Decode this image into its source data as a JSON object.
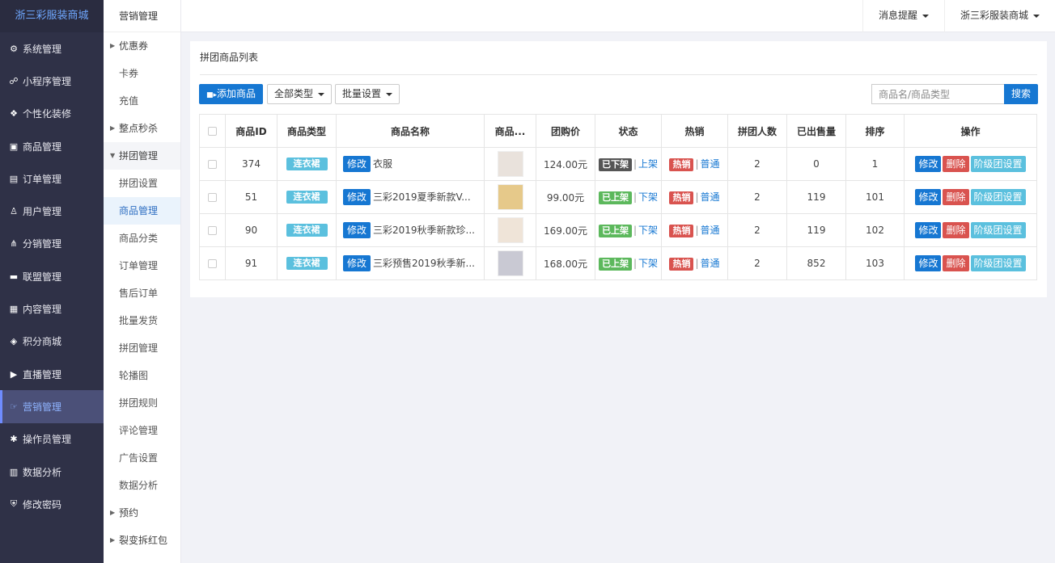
{
  "brand": "浙三彩服装商城",
  "nav": [
    {
      "label": "系统管理",
      "icon": "gear-icon",
      "glyph": "⚙"
    },
    {
      "label": "小程序管理",
      "icon": "link-icon",
      "glyph": "☍"
    },
    {
      "label": "个性化装修",
      "icon": "palette-icon",
      "glyph": "❖"
    },
    {
      "label": "商品管理",
      "icon": "bag-icon",
      "glyph": "▣"
    },
    {
      "label": "订单管理",
      "icon": "clipboard-icon",
      "glyph": "▤"
    },
    {
      "label": "用户管理",
      "icon": "user-icon",
      "glyph": "♙"
    },
    {
      "label": "分销管理",
      "icon": "sitemap-icon",
      "glyph": "⋔"
    },
    {
      "label": "联盟管理",
      "icon": "store-icon",
      "glyph": "▬"
    },
    {
      "label": "内容管理",
      "icon": "newspaper-icon",
      "glyph": "▦"
    },
    {
      "label": "积分商城",
      "icon": "cube-icon",
      "glyph": "◈"
    },
    {
      "label": "直播管理",
      "icon": "play-icon",
      "glyph": "▶"
    },
    {
      "label": "营销管理",
      "icon": "marketing-icon",
      "glyph": "☞"
    },
    {
      "label": "操作员管理",
      "icon": "cog-icon",
      "glyph": "✱"
    },
    {
      "label": "数据分析",
      "icon": "bar-chart-icon",
      "glyph": "▥"
    },
    {
      "label": "修改密码",
      "icon": "shield-icon",
      "glyph": "⛨"
    }
  ],
  "subnav": {
    "title": "营销管理",
    "items": [
      {
        "label": "优惠券",
        "type": "group"
      },
      {
        "label": "卡券",
        "type": "item"
      },
      {
        "label": "充值",
        "type": "item"
      },
      {
        "label": "整点秒杀",
        "type": "group"
      },
      {
        "label": "拼团管理",
        "type": "open"
      },
      {
        "label": "拼团设置",
        "type": "item"
      },
      {
        "label": "商品管理",
        "type": "active"
      },
      {
        "label": "商品分类",
        "type": "item"
      },
      {
        "label": "订单管理",
        "type": "item"
      },
      {
        "label": "售后订单",
        "type": "item"
      },
      {
        "label": "批量发货",
        "type": "item"
      },
      {
        "label": "拼团管理",
        "type": "item"
      },
      {
        "label": "轮播图",
        "type": "item"
      },
      {
        "label": "拼团规则",
        "type": "item"
      },
      {
        "label": "评论管理",
        "type": "item"
      },
      {
        "label": "广告设置",
        "type": "item"
      },
      {
        "label": "数据分析",
        "type": "item"
      },
      {
        "label": "预约",
        "type": "group"
      },
      {
        "label": "裂变拆红包",
        "type": "group"
      }
    ]
  },
  "header": {
    "messages": "消息提醒",
    "store": "浙三彩服装商城"
  },
  "panel": {
    "title": "拼团商品列表",
    "add_btn": "添加商品",
    "type_filter": "全部类型",
    "batch": "批量设置",
    "search_placeholder": "商品名/商品类型",
    "search_btn": "搜索"
  },
  "table": {
    "headers": [
      "",
      "商品ID",
      "商品类型",
      "商品名称",
      "商品...",
      "团购价",
      "状态",
      "热销",
      "拼团人数",
      "已出售量",
      "排序",
      "操作"
    ],
    "rows": [
      {
        "id": "374",
        "type": "连衣裙",
        "name": "衣服",
        "price": "124.00元",
        "status": "已下架",
        "status_link": "上架",
        "hot": "热销",
        "normal": "普通",
        "group_size": "2",
        "sold": "0",
        "sort": "1"
      },
      {
        "id": "51",
        "type": "连衣裙",
        "name": "三彩2019夏季新款V...",
        "price": "99.00元",
        "status": "已上架",
        "status_link": "下架",
        "hot": "热销",
        "normal": "普通",
        "group_size": "2",
        "sold": "119",
        "sort": "101"
      },
      {
        "id": "90",
        "type": "连衣裙",
        "name": "三彩2019秋季新款珍...",
        "price": "169.00元",
        "status": "已上架",
        "status_link": "下架",
        "hot": "热销",
        "normal": "普通",
        "group_size": "2",
        "sold": "119",
        "sort": "102"
      },
      {
        "id": "91",
        "type": "连衣裙",
        "name": "三彩预售2019秋季新...",
        "price": "168.00元",
        "status": "已上架",
        "status_link": "下架",
        "hot": "热销",
        "normal": "普通",
        "group_size": "2",
        "sold": "852",
        "sort": "103"
      }
    ],
    "edit_label": "修改",
    "op_edit": "修改",
    "op_delete": "删除",
    "op_tier": "阶级团设置"
  },
  "colors": {
    "sidebar": "#2f3147",
    "primary": "#1677d2",
    "danger": "#d9534f",
    "success": "#5cb85c",
    "info": "#5bc0de"
  }
}
